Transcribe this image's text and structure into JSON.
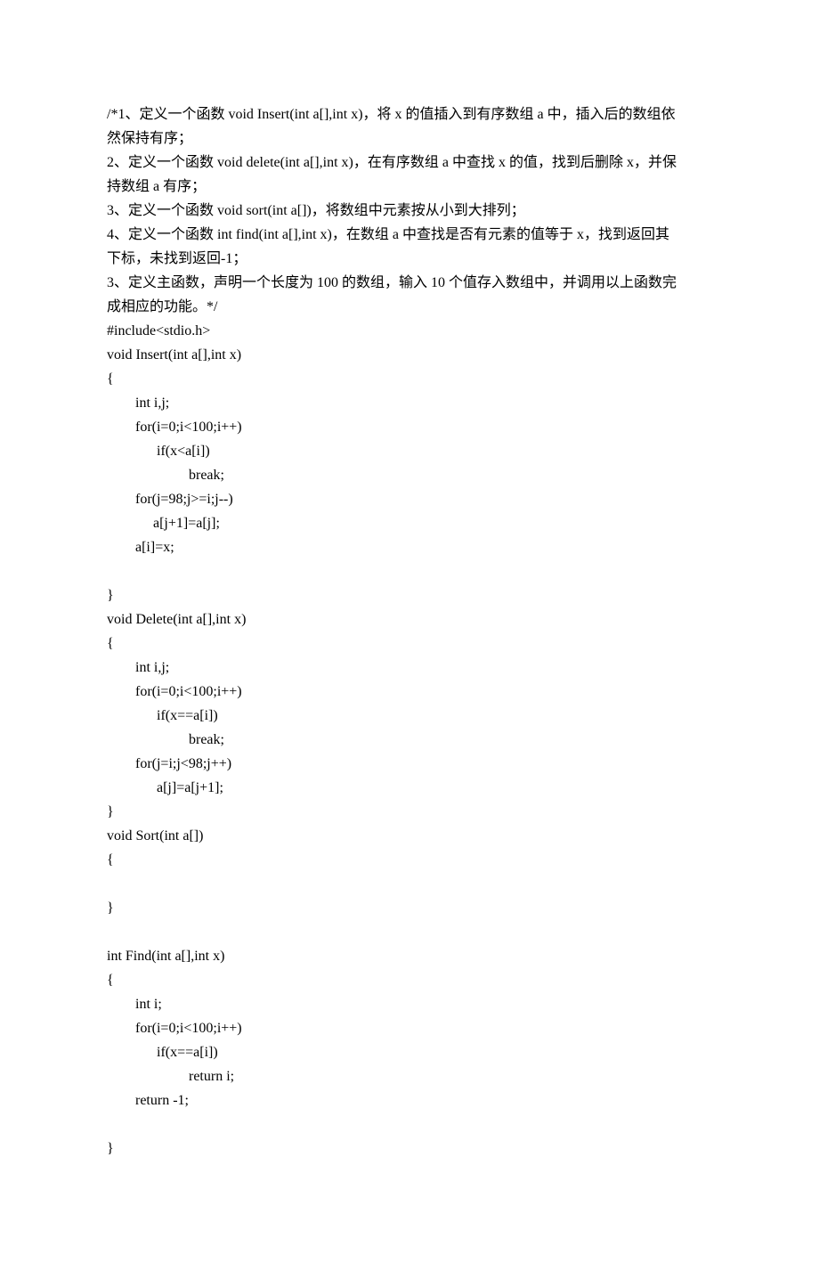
{
  "lines": [
    "/*1、定义一个函数 void Insert(int a[],int x)，将 x 的值插入到有序数组 a 中，插入后的数组依",
    "然保持有序；",
    "2、定义一个函数 void delete(int a[],int x)，在有序数组 a 中查找 x 的值，找到后删除 x，并保",
    "持数组 a 有序；",
    "3、定义一个函数 void sort(int a[])，将数组中元素按从小到大排列；",
    "4、定义一个函数 int find(int a[],int x)，在数组 a 中查找是否有元素的值等于 x，找到返回其",
    "下标，未找到返回-1；",
    "3、定义主函数，声明一个长度为 100 的数组，输入 10 个值存入数组中，并调用以上函数完",
    "成相应的功能。*/",
    "#include<stdio.h>",
    "void Insert(int a[],int x)",
    "{",
    "        int i,j;",
    "        for(i=0;i<100;i++)",
    "              if(x<a[i])",
    "                       break;",
    "        for(j=98;j>=i;j--)",
    "             a[j+1]=a[j];",
    "        a[i]=x;",
    "",
    "}",
    "void Delete(int a[],int x)",
    "{",
    "        int i,j;",
    "        for(i=0;i<100;i++)",
    "              if(x==a[i])",
    "                       break;",
    "        for(j=i;j<98;j++)",
    "              a[j]=a[j+1];",
    "}",
    "void Sort(int a[])",
    "{",
    "",
    "}",
    "",
    "int Find(int a[],int x)",
    "{",
    "        int i;",
    "        for(i=0;i<100;i++)",
    "              if(x==a[i])",
    "                       return i;",
    "        return -1;",
    "",
    "}"
  ]
}
